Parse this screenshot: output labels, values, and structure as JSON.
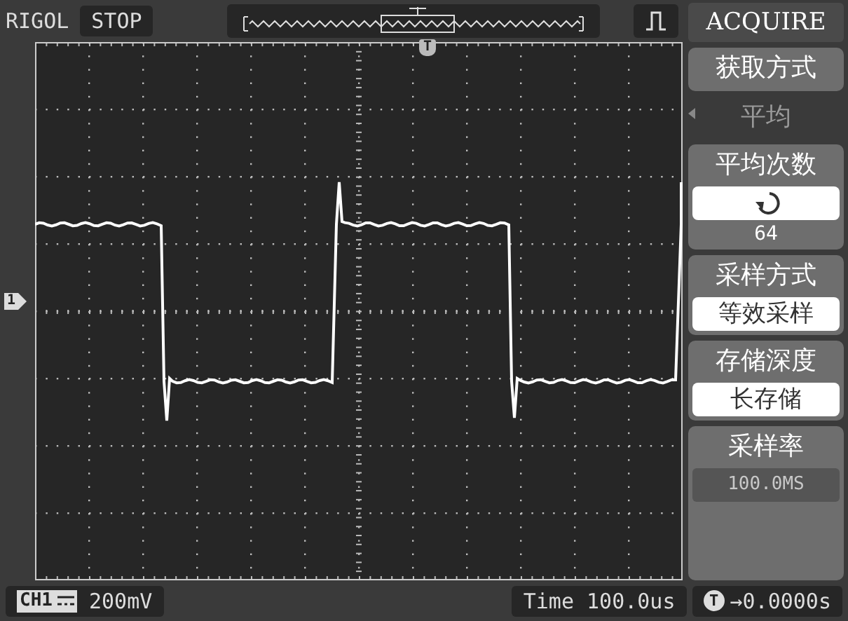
{
  "top_bar": {
    "brand": "RIGOL",
    "run_state": "STOP"
  },
  "plot": {
    "trigger_marker": "T",
    "channel_marker": "1"
  },
  "menu": {
    "title": "ACQUIRE",
    "items": [
      {
        "kind": "select",
        "label": "获取方式",
        "value": "平均"
      },
      {
        "kind": "knob",
        "label": "平均次数",
        "value": "64"
      },
      {
        "kind": "boxed",
        "label": "采样方式",
        "value": "等效采样"
      },
      {
        "kind": "boxed",
        "label": "存储深度",
        "value": "长存储"
      },
      {
        "kind": "disabled",
        "label": "采样率",
        "value": "100.0MS"
      }
    ]
  },
  "bottom_bar": {
    "channel": "CH1",
    "volts_per_div": "200mV",
    "timebase": "Time 100.0us",
    "trigger_badge": "T",
    "trigger_offset": "→0.0000s"
  }
}
